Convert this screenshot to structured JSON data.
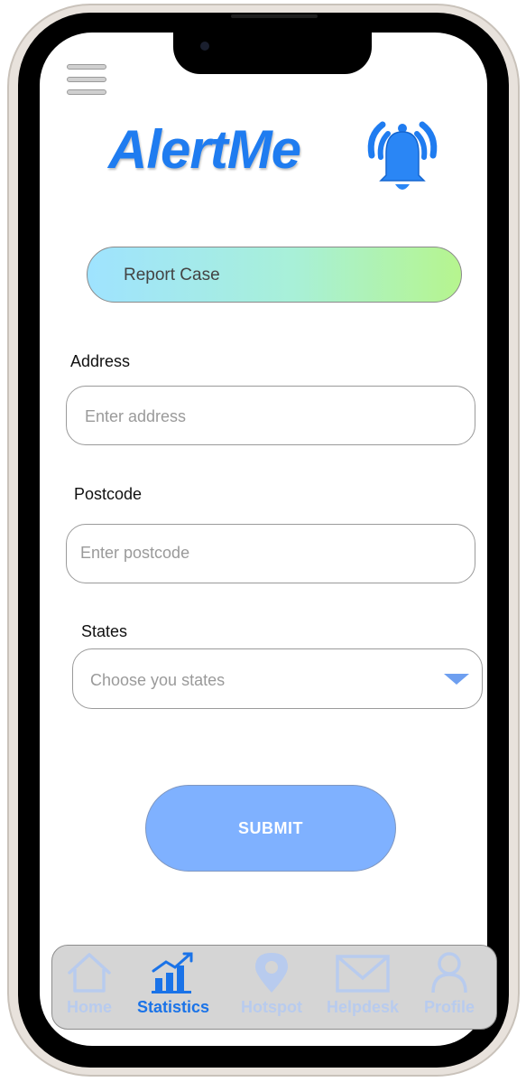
{
  "app": {
    "logo_text": "AlertMe",
    "brand_color": "#1f7cf0"
  },
  "header": {
    "menu_icon": "hamburger-menu-icon"
  },
  "report_case": {
    "label": "Report Case"
  },
  "form": {
    "address": {
      "label": "Address",
      "placeholder": "Enter address"
    },
    "postcode": {
      "label": "Postcode",
      "placeholder": "Enter postcode"
    },
    "states": {
      "label": "States",
      "placeholder": "Choose you states"
    },
    "submit_label": "SUBMIT"
  },
  "tabbar": {
    "active_color": "#1a73e8",
    "inactive_color": "#b8cbee",
    "items": [
      {
        "label": "Home",
        "icon": "home-icon",
        "active": false
      },
      {
        "label": "Statistics",
        "icon": "statistics-icon",
        "active": true
      },
      {
        "label": "Hotspot",
        "icon": "location-pin-icon",
        "active": false
      },
      {
        "label": "Helpdesk",
        "icon": "mail-icon",
        "active": false
      },
      {
        "label": "Profile",
        "icon": "profile-icon",
        "active": false
      }
    ]
  }
}
